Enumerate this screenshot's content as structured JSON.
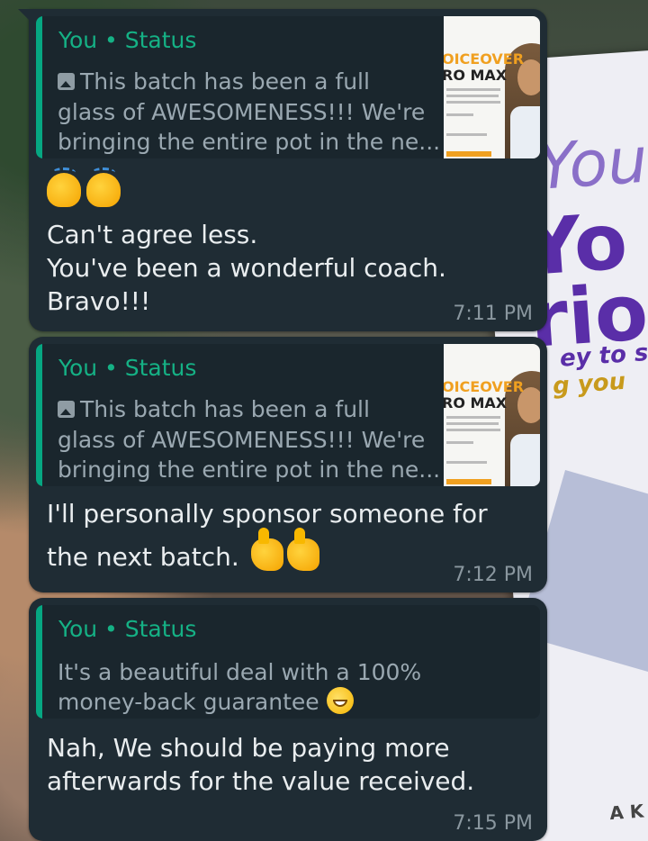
{
  "messages": [
    {
      "quote": {
        "author": "You",
        "separator": " • ",
        "source": "Status",
        "lines": [
          "This batch has been a full",
          "glass of AWESOMENESS!!! We're",
          "bringing the entire pot in the ne..."
        ],
        "thumb_title1": "OICEOVER",
        "thumb_title2": "RO MAX"
      },
      "emoji_line": "👏👏",
      "text_lines": [
        "Can't agree less.",
        "You've been a wonderful coach.",
        "Bravo!!!"
      ],
      "time": "7:11 PM"
    },
    {
      "quote": {
        "author": "You",
        "separator": " • ",
        "source": "Status",
        "lines": [
          "This batch has been a full",
          "glass of AWESOMENESS!!! We're",
          "bringing the entire pot in the ne..."
        ],
        "thumb_title1": "OICEOVER",
        "thumb_title2": "RO MAX"
      },
      "text_lines": [
        "I'll personally sponsor someone for",
        "the next batch."
      ],
      "emoji_trailing": "👍👍",
      "time": "7:12 PM"
    },
    {
      "quote": {
        "author": "You",
        "separator": " • ",
        "source": "Status",
        "lines": [
          "It's a beautiful deal with a 100%",
          "money-back guarantee"
        ],
        "emoji": "😁"
      },
      "text_lines": [
        "Nah, We should be paying more",
        "afterwards for the value received."
      ],
      "time": "7:15 PM"
    }
  ],
  "wallpaper_text": {
    "line1": "You",
    "line2": "Yo",
    "line3": "rio",
    "line4": "ey to su",
    "line5": "g you",
    "line6": "A K"
  },
  "colors": {
    "bubble": "#1f2c34",
    "quote_bg": "#1a262d",
    "accent": "#06a782",
    "text": "#e9edef",
    "muted": "#8a979f"
  }
}
